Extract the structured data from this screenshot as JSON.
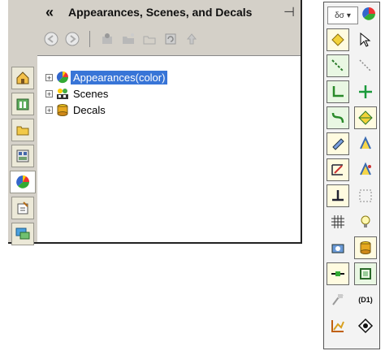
{
  "panel": {
    "collapse_glyph": "«",
    "title": "Appearances, Scenes, and Decals",
    "pin_glyph": "⊣"
  },
  "toolbar": {
    "buttons": [
      "back-icon",
      "forward-icon",
      "paint-icon",
      "open-folder-icon",
      "new-folder-icon",
      "refresh-icon",
      "up-icon"
    ]
  },
  "vertical_tabs": [
    "home-icon",
    "design-library-icon",
    "file-explorer-icon",
    "view-palette-icon",
    "appearances-icon",
    "custom-properties-icon",
    "forum-icon"
  ],
  "tree": {
    "items": [
      {
        "label": "Appearances(color)",
        "selected": true,
        "icon": "color-ball-icon"
      },
      {
        "label": "Scenes",
        "selected": false,
        "icon": "scene-icon"
      },
      {
        "label": "Decals",
        "selected": false,
        "icon": "decal-icon"
      }
    ]
  },
  "side_strip": {
    "dropdown_label": "δσ",
    "label_d1": "(D1)"
  },
  "colors": {
    "selection": "#3875d7",
    "panel_bg": "#d4d0c8"
  }
}
